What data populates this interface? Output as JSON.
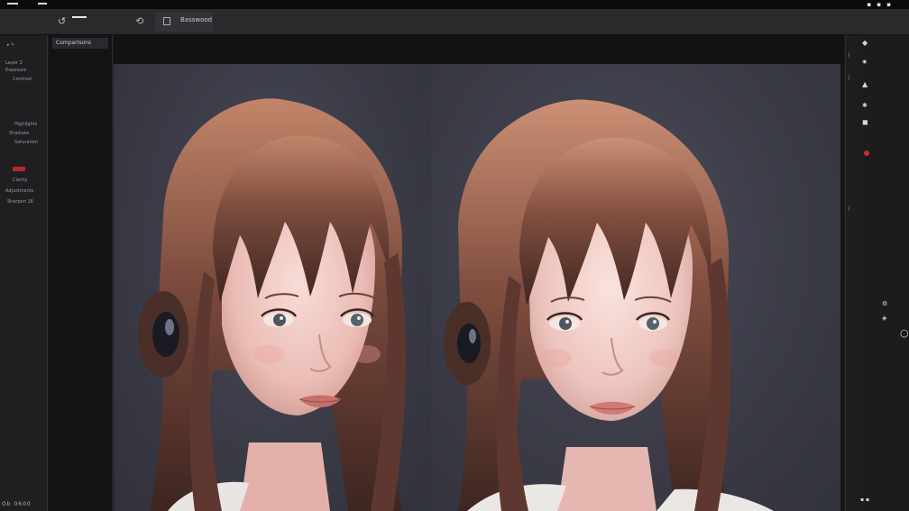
{
  "toolbar": {
    "group_label": "Basswood",
    "icons": [
      "rotate-icon",
      "history-icon",
      "layer-icon"
    ]
  },
  "layers_panel": {
    "tab_label": "Comparisons"
  },
  "left_panel": {
    "labels": [
      "Layer 3",
      "Exposure",
      "Contrast",
      "Highlights",
      "Shadows",
      "Saturation",
      "Clarity",
      "Adjustments",
      "Sharpen 16"
    ],
    "footer": "Ob 0600"
  },
  "props_panel": {
    "icons": [
      "brush-icon",
      "eye-icon",
      "mask-icon",
      "stamp-icon",
      "color-dot-icon",
      "pen-icon",
      "ring-icon"
    ]
  },
  "colors": {
    "accent_red": "#c9302c",
    "canvas_bg": "#3b3c47",
    "panel_bg": "#1f1f22"
  }
}
